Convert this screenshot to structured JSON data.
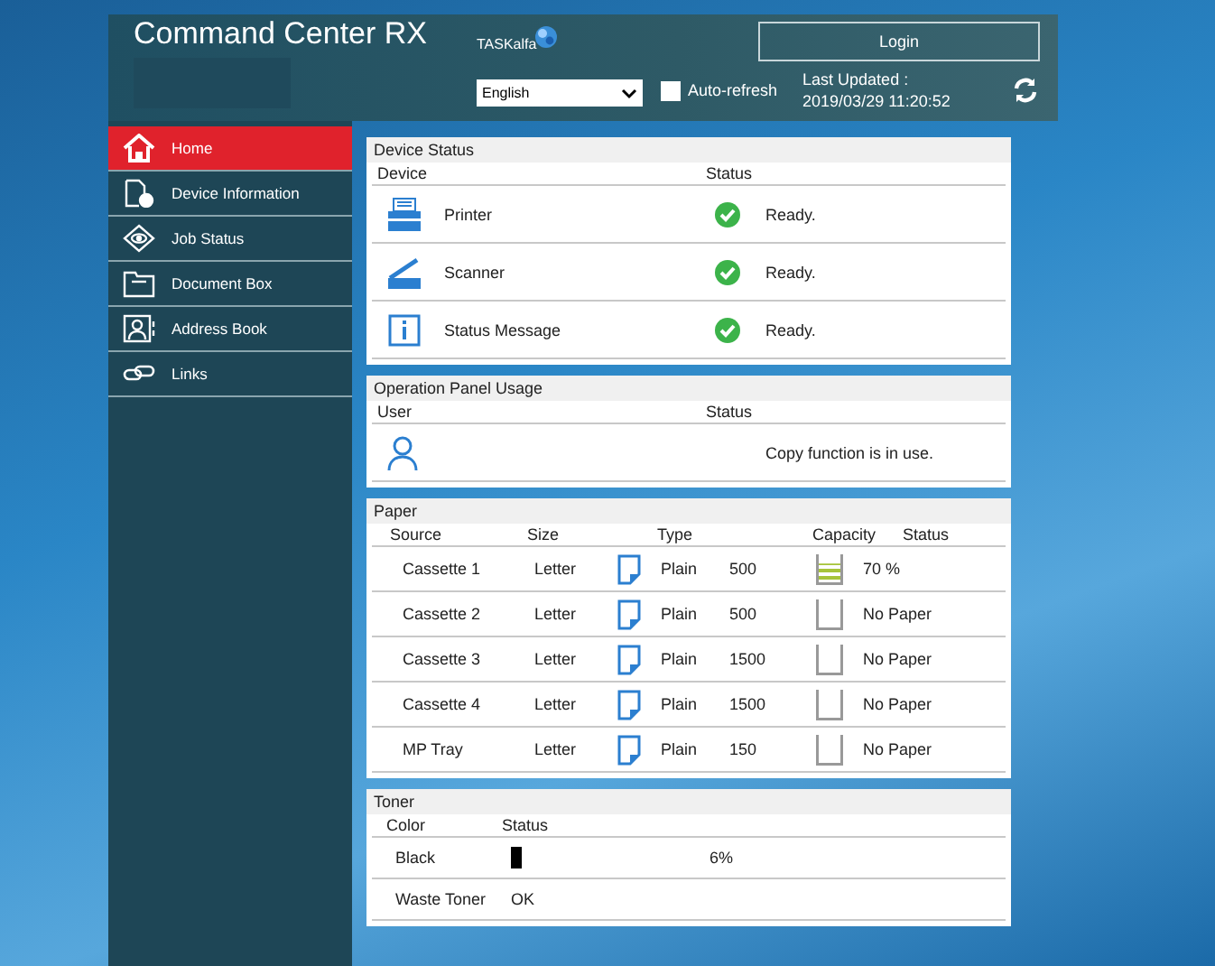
{
  "header": {
    "title": "Command Center RX",
    "model_logo": "TASKalfa",
    "language": "English",
    "auto_refresh": {
      "label": "Auto-refresh",
      "checked": false
    },
    "last_updated_label": "Last Updated :",
    "last_updated": "2019/03/29 11:20:52",
    "login": "Login"
  },
  "sidebar": {
    "items": [
      {
        "label": "Home",
        "kind": "home",
        "selected": true
      },
      {
        "label": "Device Information",
        "kind": "device",
        "selected": false
      },
      {
        "label": "Job Status",
        "kind": "job",
        "selected": false
      },
      {
        "label": "Document Box",
        "kind": "box",
        "selected": false
      },
      {
        "label": "Address Book",
        "kind": "address",
        "selected": false
      },
      {
        "label": "Links",
        "kind": "links",
        "selected": false
      }
    ]
  },
  "device_status": {
    "title": "Device Status",
    "columns": [
      "Device",
      "Status"
    ],
    "rows": [
      {
        "kind": "printer",
        "device": "Printer",
        "status": "Ready."
      },
      {
        "kind": "scanner",
        "device": "Scanner",
        "status": "Ready."
      },
      {
        "kind": "info",
        "device": "Status Message",
        "status": "Ready."
      }
    ]
  },
  "operation_panel": {
    "title": "Operation Panel Usage",
    "columns": [
      "User",
      "Status"
    ],
    "status": "Copy function is in use."
  },
  "paper": {
    "title": "Paper",
    "columns": [
      "Source",
      "Size",
      "Type",
      "Capacity",
      "Status"
    ],
    "rows": [
      {
        "source": "Cassette 1",
        "size": "Letter",
        "type": "Plain",
        "capacity": "500",
        "level": 0.7,
        "status": "70 %"
      },
      {
        "source": "Cassette 2",
        "size": "Letter",
        "type": "Plain",
        "capacity": "500",
        "level": 0,
        "status": "No Paper"
      },
      {
        "source": "Cassette 3",
        "size": "Letter",
        "type": "Plain",
        "capacity": "1500",
        "level": 0,
        "status": "No Paper"
      },
      {
        "source": "Cassette 4",
        "size": "Letter",
        "type": "Plain",
        "capacity": "1500",
        "level": 0,
        "status": "No Paper"
      },
      {
        "source": "MP Tray",
        "size": "Letter",
        "type": "Plain",
        "capacity": "150",
        "level": 0,
        "status": "No Paper"
      }
    ]
  },
  "toner": {
    "title": "Toner",
    "columns": [
      "Color",
      "Status"
    ],
    "rows": [
      {
        "kind": "bar",
        "name": "Black",
        "level": 0.06,
        "reading": "6%"
      },
      {
        "kind": "text",
        "name": "Waste Toner",
        "status": "OK"
      }
    ]
  }
}
